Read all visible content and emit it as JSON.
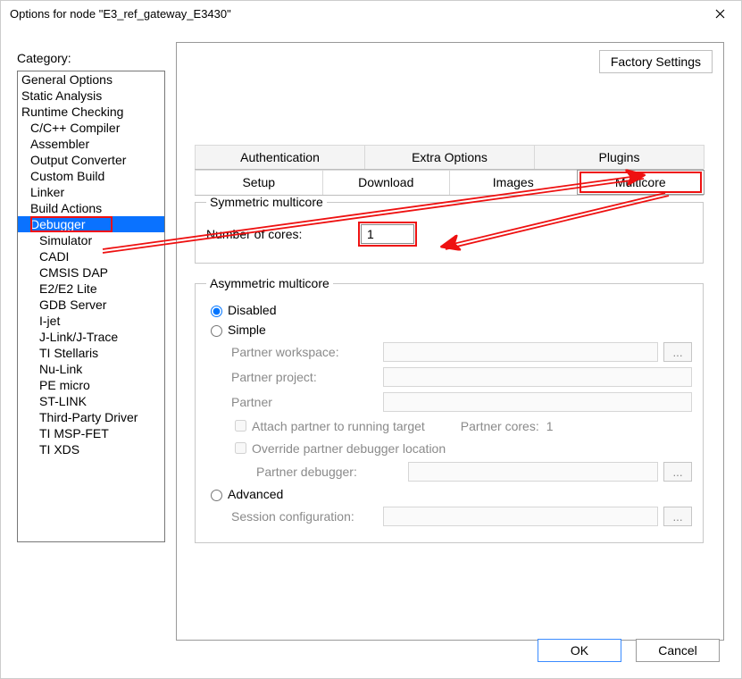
{
  "window_title": "Options for node \"E3_ref_gateway_E3430\"",
  "category_label": "Category:",
  "factory_settings_label": "Factory Settings",
  "categories": {
    "c0": "General Options",
    "c1": "Static Analysis",
    "c2": "Runtime Checking",
    "c3": "C/C++ Compiler",
    "c4": "Assembler",
    "c5": "Output Converter",
    "c6": "Custom Build",
    "c7": "Linker",
    "c8": "Build Actions",
    "c9": "Debugger",
    "c10": "Simulator",
    "c11": "CADI",
    "c12": "CMSIS DAP",
    "c13": "E2/E2 Lite",
    "c14": "GDB Server",
    "c15": "I-jet",
    "c16": "J-Link/J-Trace",
    "c17": "TI Stellaris",
    "c18": "Nu-Link",
    "c19": "PE micro",
    "c20": "ST-LINK",
    "c21": "Third-Party Driver",
    "c22": "TI MSP-FET",
    "c23": "TI XDS"
  },
  "tabs_back": {
    "t0": "Authentication",
    "t1": "Extra Options",
    "t2": "Plugins"
  },
  "tabs_front": {
    "t0": "Setup",
    "t1": "Download",
    "t2": "Images",
    "t3": "Multicore"
  },
  "sym": {
    "legend": "Symmetric multicore",
    "cores_label": "Number of cores:",
    "cores_value": "1"
  },
  "asym": {
    "legend": "Asymmetric multicore",
    "disabled": "Disabled",
    "simple": "Simple",
    "advanced": "Advanced",
    "partner_workspace": "Partner workspace:",
    "partner_project": "Partner project:",
    "partner": "Partner",
    "attach": "Attach partner to running target",
    "partner_cores_label": "Partner cores:",
    "partner_cores_value": "1",
    "override": "Override partner debugger location",
    "partner_debugger": "Partner debugger:",
    "session_config": "Session configuration:",
    "browse": "..."
  },
  "footer": {
    "ok": "OK",
    "cancel": "Cancel"
  }
}
